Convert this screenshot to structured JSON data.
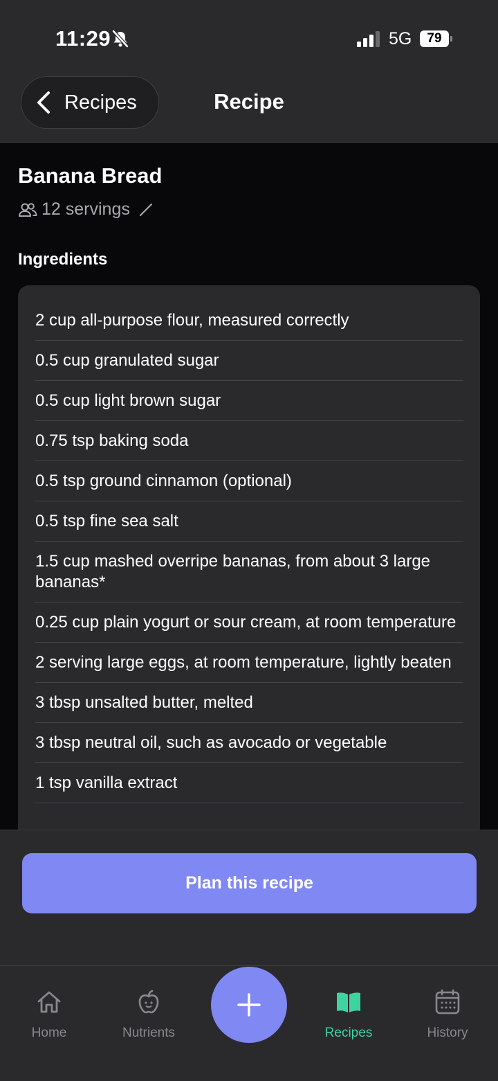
{
  "status_bar": {
    "time": "11:29",
    "network": "5G",
    "battery": "79"
  },
  "header": {
    "back_label": "Recipes",
    "title": "Recipe"
  },
  "recipe": {
    "name": "Banana Bread",
    "servings": "12 servings",
    "ingredients_title": "Ingredients",
    "ingredients": [
      "2 cup all-purpose flour, measured correctly",
      "0.5 cup granulated sugar",
      "0.5 cup light brown sugar",
      "0.75 tsp baking soda",
      "0.5 tsp ground cinnamon (optional)",
      "0.5 tsp fine sea salt",
      "1.5 cup mashed overripe bananas, from about 3 large bananas*",
      "0.25 cup plain yogurt or sour cream, at room temperature",
      "2 serving large eggs, at room temperature, lightly beaten",
      "3 tbsp unsalted butter, melted",
      "3 tbsp neutral oil, such as avocado or vegetable",
      "1 tsp vanilla extract"
    ]
  },
  "action": {
    "plan_label": "Plan this recipe"
  },
  "tabs": [
    {
      "label": "Home",
      "icon": "home-icon"
    },
    {
      "label": "Nutrients",
      "icon": "apple-icon"
    },
    {
      "label": "Recipes",
      "icon": "book-icon",
      "active": true
    },
    {
      "label": "History",
      "icon": "calendar-icon"
    }
  ],
  "fab": {
    "icon": "plus-icon"
  },
  "colors": {
    "accent": "#8088f3",
    "active_tab": "#3fd3a0",
    "surface": "#2a2a2d",
    "background": "#08080a"
  }
}
